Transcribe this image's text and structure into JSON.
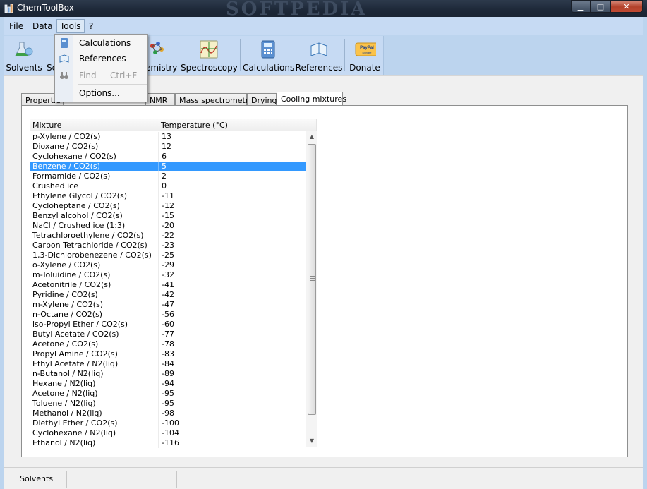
{
  "window": {
    "title": "ChemToolBox",
    "watermark": "SOFTPEDIA"
  },
  "menu": [
    "File",
    "Data",
    "Tools",
    "?"
  ],
  "toolbar": [
    "Solvents",
    "Sc",
    "emistry",
    "Spectroscopy",
    "Calculations",
    "References",
    "Donate"
  ],
  "dropdown": {
    "items": [
      {
        "label": "Calculations",
        "shortcut": "",
        "icon": "calculator-icon",
        "enabled": true
      },
      {
        "label": "References",
        "shortcut": "",
        "icon": "book-icon",
        "enabled": true
      },
      {
        "label": "Find",
        "shortcut": "Ctrl+F",
        "icon": "binoculars-icon",
        "enabled": false
      },
      {
        "label": "Options...",
        "shortcut": "",
        "icon": "",
        "enabled": true
      }
    ]
  },
  "tabs": [
    "Propertie",
    "NMR",
    "Mass spectrometry",
    "Drying",
    "Cooling mixtures"
  ],
  "selected_tab": "Cooling mixtures",
  "table": {
    "headers": [
      "Mixture",
      "Temperature (°C)"
    ],
    "rows": [
      [
        "p-Xylene / CO2(s)",
        "13"
      ],
      [
        "Dioxane / CO2(s)",
        "12"
      ],
      [
        "Cyclohexane / CO2(s)",
        "6"
      ],
      [
        "Benzene / CO2(s)",
        "5"
      ],
      [
        "Formamide / CO2(s)",
        "2"
      ],
      [
        "Crushed ice",
        "0"
      ],
      [
        "Ethylene Glycol / CO2(s)",
        "-11"
      ],
      [
        "Cycloheptane / CO2(s)",
        "-12"
      ],
      [
        "Benzyl alcohol / CO2(s)",
        "-15"
      ],
      [
        "NaCl / Crushed ice (1:3)",
        "-20"
      ],
      [
        "Tetrachloroethylene / CO2(s)",
        "-22"
      ],
      [
        "Carbon Tetrachloride / CO2(s)",
        "-23"
      ],
      [
        "1,3-Dichlorobenezene / CO2(s)",
        "-25"
      ],
      [
        "o-Xylene / CO2(s)",
        "-29"
      ],
      [
        "m-Toluidine / CO2(s)",
        "-32"
      ],
      [
        "Acetonitrile / CO2(s)",
        "-41"
      ],
      [
        "Pyridine / CO2(s)",
        "-42"
      ],
      [
        "m-Xylene / CO2(s)",
        "-47"
      ],
      [
        "n-Octane / CO2(s)",
        "-56"
      ],
      [
        "iso-Propyl Ether / CO2(s)",
        "-60"
      ],
      [
        "Butyl Acetate / CO2(s)",
        "-77"
      ],
      [
        "Acetone / CO2(s)",
        "-78"
      ],
      [
        "Propyl Amine / CO2(s)",
        "-83"
      ],
      [
        "Ethyl Acetate / N2(liq)",
        "-84"
      ],
      [
        "n-Butanol / N2(liq)",
        "-89"
      ],
      [
        "Hexane / N2(liq)",
        "-94"
      ],
      [
        "Acetone / N2(liq)",
        "-95"
      ],
      [
        "Toluene / N2(liq)",
        "-95"
      ],
      [
        "Methanol / N2(liq)",
        "-98"
      ],
      [
        "Diethyl Ether / CO2(s)",
        "-100"
      ],
      [
        "Cyclohexane / N2(liq)",
        "-104"
      ],
      [
        "Ethanol / N2(liq)",
        "-116"
      ]
    ],
    "selected_row": 3
  },
  "status": {
    "text": "Solvents"
  },
  "colors": {
    "selection": "#3399ff",
    "toolbar_bg": "#c6daf3",
    "titlebar": "#1d2838"
  }
}
